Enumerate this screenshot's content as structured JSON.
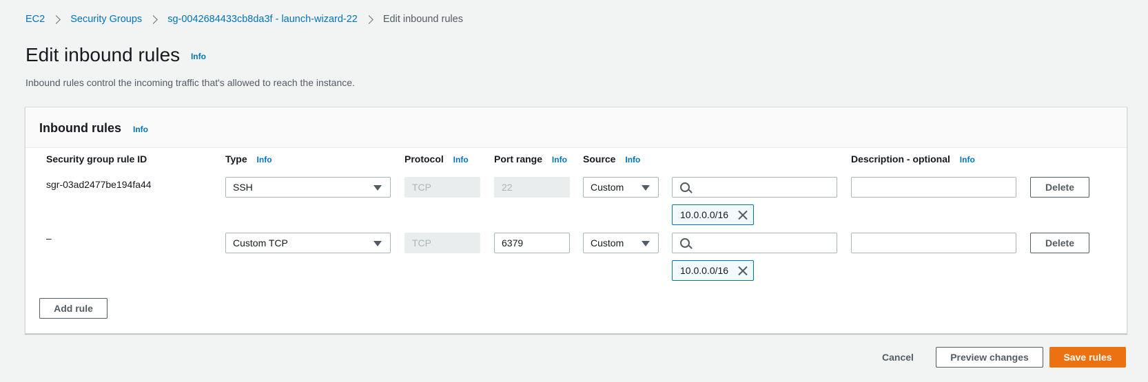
{
  "breadcrumb": {
    "items": [
      "EC2",
      "Security Groups",
      "sg-0042684433cb8da3f - launch-wizard-22"
    ],
    "current": "Edit inbound rules"
  },
  "page": {
    "title": "Edit inbound rules",
    "info": "Info",
    "description": "Inbound rules control the incoming traffic that's allowed to reach the instance."
  },
  "panel": {
    "title": "Inbound rules",
    "info": "Info",
    "columns": {
      "rule_id": "Security group rule ID",
      "type": "Type",
      "protocol": "Protocol",
      "port_range": "Port range",
      "source": "Source",
      "description": "Description - optional",
      "info": "Info"
    },
    "rows": [
      {
        "rule_id": "sgr-03ad2477be194fa44",
        "type": "SSH",
        "protocol": "TCP",
        "port_range": "22",
        "source": "Custom",
        "cidr": "10.0.0.0/16",
        "description": "",
        "delete": "Delete"
      },
      {
        "rule_id": "–",
        "type": "Custom TCP",
        "protocol": "TCP",
        "port_range": "6379",
        "source": "Custom",
        "cidr": "10.0.0.0/16",
        "description": "",
        "delete": "Delete"
      }
    ],
    "add_rule": "Add rule"
  },
  "footer": {
    "cancel": "Cancel",
    "preview": "Preview changes",
    "save": "Save rules"
  },
  "colors": {
    "link": "#0073bb",
    "primary": "#ec7211",
    "background": "#f2f3f3"
  }
}
